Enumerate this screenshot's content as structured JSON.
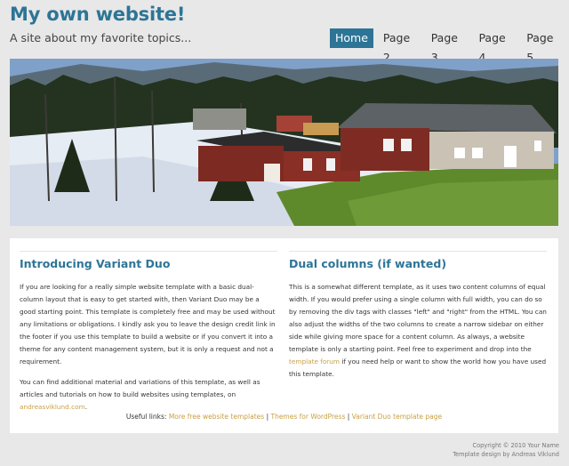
{
  "header": {
    "title": "My own website!",
    "tagline": "A site about my favorite topics..."
  },
  "nav": {
    "items": [
      {
        "label": "Home",
        "active": true
      },
      {
        "label": "Page 2",
        "active": false
      },
      {
        "label": "Page 3",
        "active": false
      },
      {
        "label": "Page 4",
        "active": false
      },
      {
        "label": "Page 5",
        "active": false
      }
    ]
  },
  "main": {
    "left": {
      "heading": "Introducing Variant Duo",
      "para1": "If you are looking for a really simple website template with a basic dual-column layout that is easy to get started with, then Variant Duo may be a good starting point. This template is completely free and may be used without any limitations or obligations. I kindly ask you to leave the design credit link in the footer if you use this template to build a website or if you convert it into a theme for any content management system, but it is only a request and not a requirement.",
      "para2_text": "You can find additional material and variations of this template, as well as articles and tutorials on how to build websites using templates, on ",
      "para2_link": "andreasviklund.com",
      "para2_end": "."
    },
    "right": {
      "heading": "Dual columns (if wanted)",
      "para_text": "This is a somewhat different template, as it uses two content columns of equal width. If you would prefer using a single column with full width, you can do so by removing the div tags with classes \"left\" and \"right\" from the HTML. You can also adjust the widths of the two columns to create a narrow sidebar on either side while giving more space for a content column. As always, a website template is only a starting point. Feel free to experiment and drop into the ",
      "para_link": "template forum",
      "para_end": " if you need help or want to show the world how you have used this template."
    },
    "useful_links": {
      "label": "Useful links:",
      "links": [
        "More free website templates",
        "Themes for WordPress",
        "Variant Duo template page"
      ],
      "separator": "|"
    }
  },
  "footer": {
    "copyright": "Copyright © 2010 Your Name",
    "credit": "Template design by Andreas Viklund"
  },
  "colors": {
    "accent": "#2d7596",
    "link": "#c8a046",
    "background": "#e8e8e8"
  }
}
